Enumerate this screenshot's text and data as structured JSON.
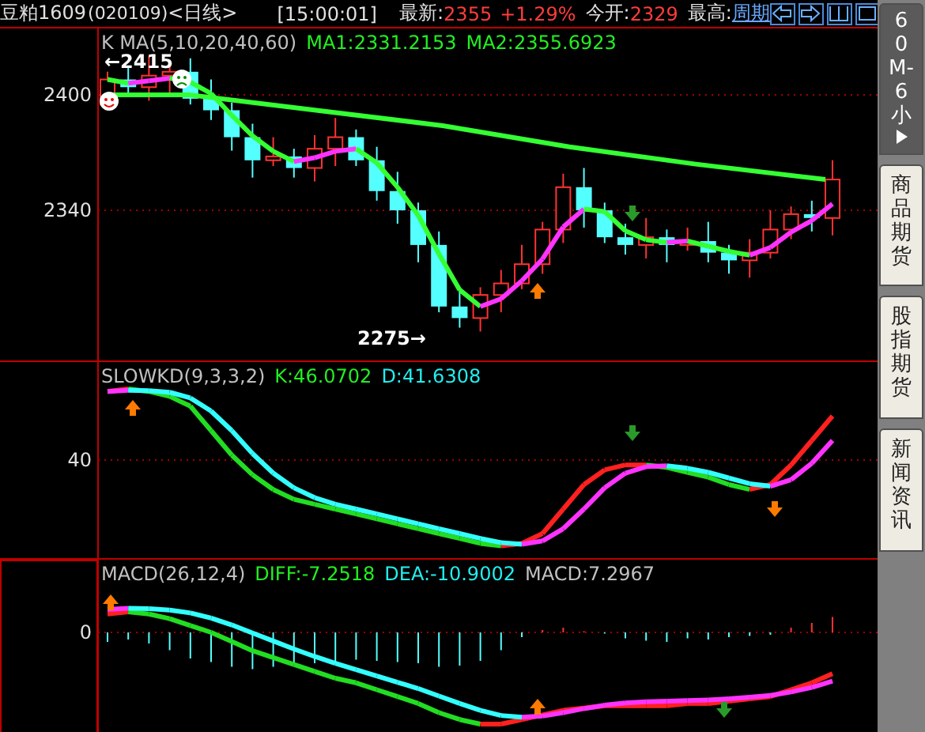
{
  "header": {
    "symbol": "豆粕1609",
    "code": "(020109)",
    "period": "<日线>",
    "time": "[15:00:01]",
    "quotes": [
      {
        "label": "最新:",
        "value": "2355",
        "change": "+1.29%"
      },
      {
        "label": "今开:",
        "value": "2329"
      },
      {
        "label": "最高:"
      }
    ],
    "link": "周期"
  },
  "panels": [
    {
      "kind": "price",
      "legend": [
        {
          "text": "K  MA(5,10,20,40,60)",
          "kind": "name"
        },
        {
          "text": "MA1:2331.2153",
          "kind": "line1"
        },
        {
          "text": "MA2:2355.6923",
          "kind": "line1"
        }
      ],
      "y_labels": [
        "2400",
        "2340"
      ],
      "high_label": "←2415",
      "low_label": "2275→"
    },
    {
      "kind": "kd",
      "legend": [
        {
          "text": "SLOWKD(9,3,3,2)",
          "kind": "name"
        },
        {
          "text": "K:46.0702",
          "kind": "line1"
        },
        {
          "text": "D:41.6308",
          "kind": "line2"
        }
      ],
      "y_labels": [
        "40"
      ]
    },
    {
      "kind": "macd",
      "legend": [
        {
          "text": "MACD(26,12,4)",
          "kind": "name"
        },
        {
          "text": "DIFF:-7.2518",
          "kind": "line1"
        },
        {
          "text": "DEA:-10.9002",
          "kind": "line2"
        },
        {
          "text": "MACD:7.2967",
          "kind": "name"
        }
      ],
      "y_labels": [
        "0"
      ]
    }
  ],
  "sidebar": {
    "tabs": [
      {
        "label": "60M-6小",
        "selected": true
      },
      {
        "label": "商品期货",
        "selected": false
      },
      {
        "label": "股指期货",
        "selected": false
      },
      {
        "label": "新闻资讯",
        "selected": false
      }
    ]
  }
}
